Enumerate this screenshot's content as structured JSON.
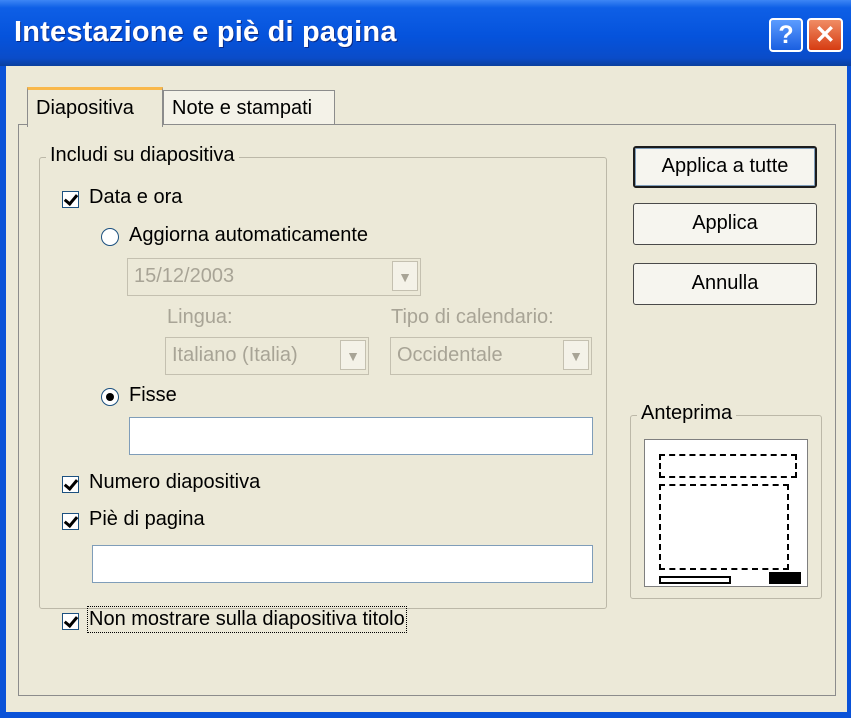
{
  "window": {
    "title": "Intestazione e piè di pagina",
    "help_glyph": "?",
    "close_glyph": "✕"
  },
  "tabs": [
    {
      "label": "Diapositiva",
      "active": true
    },
    {
      "label": "Note e stampati",
      "active": false
    }
  ],
  "include_group": {
    "label": "Includi su diapositiva",
    "date_time": {
      "label": "Data e ora",
      "checked": true
    },
    "auto_update": {
      "label": "Aggiorna automaticamente",
      "selected": false,
      "date_value": "15/12/2003",
      "language_label": "Lingua:",
      "language_value": "Italiano (Italia)",
      "calendar_label": "Tipo di calendario:",
      "calendar_value": "Occidentale"
    },
    "fixed": {
      "label": "Fisse",
      "selected": true,
      "value": ""
    },
    "slide_number": {
      "label": "Numero diapositiva",
      "checked": true
    },
    "footer": {
      "label": "Piè di pagina",
      "checked": true,
      "value": ""
    }
  },
  "dont_show_title": {
    "label": "Non mostrare sulla diapositiva titolo",
    "checked": true
  },
  "buttons": {
    "apply_all": "Applica a tutte",
    "apply": "Applica",
    "cancel": "Annulla"
  },
  "preview": {
    "label": "Anteprima"
  },
  "icons": {
    "dropdown": "chevron-down-icon",
    "help": "help-icon",
    "close": "close-icon"
  },
  "colors": {
    "titlebar": "#0553dc",
    "dialog_bg": "#ece9d8",
    "close_button": "#d63c12",
    "tab_highlight": "#f9b84b"
  }
}
